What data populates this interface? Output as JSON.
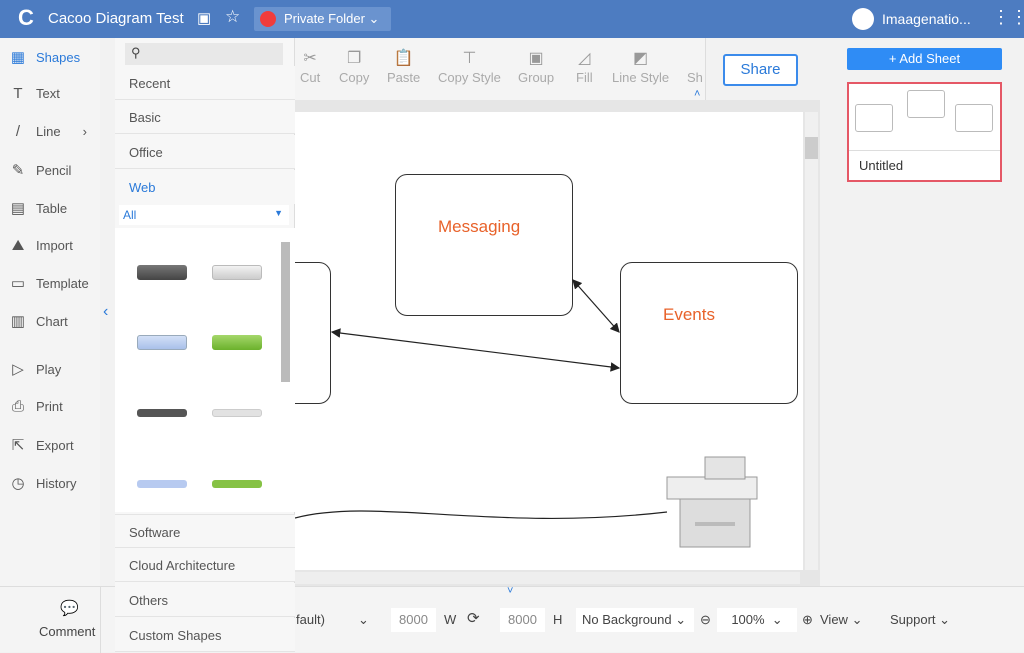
{
  "header": {
    "title": "Cacoo Diagram Test",
    "folder": "Private Folder",
    "user": "Imaagenatio..."
  },
  "nav": {
    "items": [
      {
        "label": "Shapes"
      },
      {
        "label": "Text"
      },
      {
        "label": "Line"
      },
      {
        "label": "Pencil"
      },
      {
        "label": "Table"
      },
      {
        "label": "Import"
      },
      {
        "label": "Template"
      },
      {
        "label": "Chart"
      },
      {
        "label": "Play"
      },
      {
        "label": "Print"
      },
      {
        "label": "Export"
      },
      {
        "label": "History"
      }
    ]
  },
  "panel": {
    "search_placeholder": "",
    "categories_top": [
      "Recent",
      "Basic",
      "Office",
      "Web"
    ],
    "filter": "All",
    "categories_bottom": [
      "Software",
      "Cloud Architecture",
      "Others",
      "Custom Shapes"
    ]
  },
  "toolbar": {
    "tools": [
      "Cut",
      "Copy",
      "Paste",
      "Copy Style",
      "Group",
      "Fill",
      "Line Style",
      "Sh"
    ],
    "share": "Share"
  },
  "canvas": {
    "shapes": [
      "Messaging",
      "Events"
    ]
  },
  "sheets": {
    "add_label": "+ Add Sheet",
    "items": [
      {
        "name": "Untitled"
      }
    ]
  },
  "bottom": {
    "comment": "Comment",
    "page_size": "fault)",
    "width": "8000",
    "w_label": "W",
    "height": "8000",
    "h_label": "H",
    "background": "No Background",
    "zoom": "100%",
    "view": "View",
    "support": "Support"
  },
  "colors": {
    "header": "#4d7cc1",
    "accent": "#2f8cf5",
    "shape_label": "#e8622a",
    "selected_sheet": "#e55866"
  }
}
